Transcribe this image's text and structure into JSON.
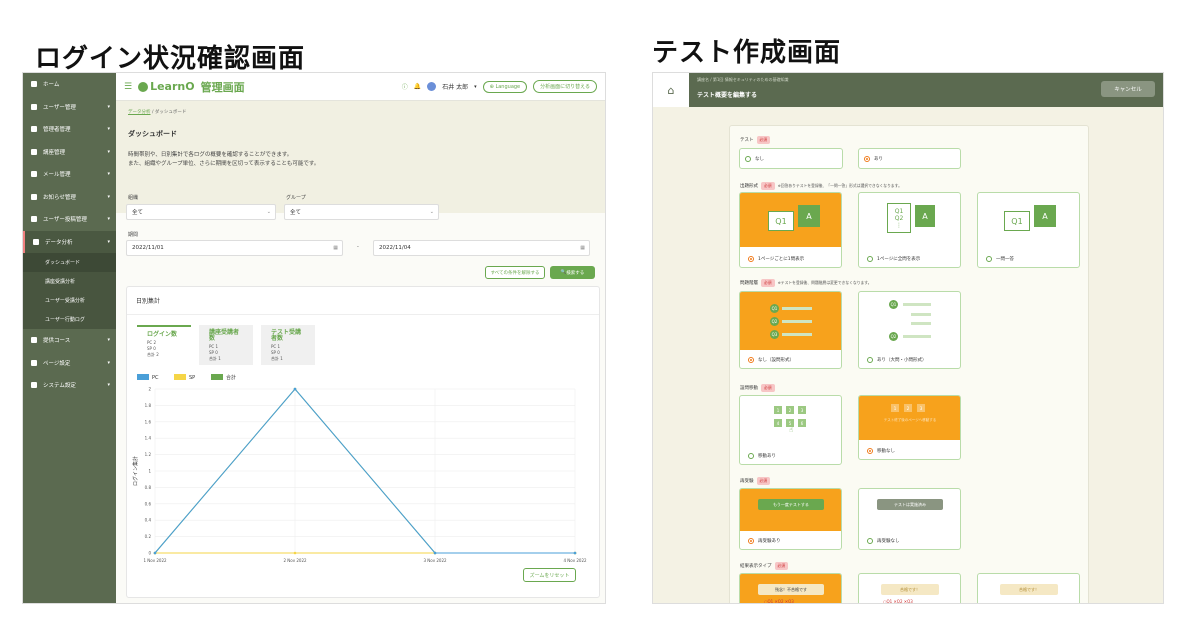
{
  "titles": {
    "left": "ログイン状況確認画面",
    "right": "テスト作成画面"
  },
  "left": {
    "sidebar": {
      "items": [
        {
          "label": "ホーム",
          "chevron": false
        },
        {
          "label": "ユーザー管理",
          "chevron": true
        },
        {
          "label": "管理者管理",
          "chevron": true
        },
        {
          "label": "講座管理",
          "chevron": true
        },
        {
          "label": "メール管理",
          "chevron": true
        },
        {
          "label": "お知らせ管理",
          "chevron": true
        },
        {
          "label": "ユーザー投稿管理",
          "chevron": true
        },
        {
          "label": "データ分析",
          "chevron": true,
          "active": true
        }
      ],
      "sub": [
        "ダッシュボード",
        "講座受講分析",
        "ユーザー受講分析",
        "ユーザー行動ログ"
      ],
      "items2": [
        {
          "label": "提供コース",
          "chevron": true
        },
        {
          "label": "ページ設定",
          "chevron": true
        },
        {
          "label": "システム設定",
          "chevron": true
        }
      ]
    },
    "topbar": {
      "logo": "LearnO",
      "admin": "管理画面",
      "user": "石井 太郎",
      "language": "Language",
      "switch": "分析画面に切り替える"
    },
    "breadcrumb": {
      "parent": "データ分析",
      "sep": "/",
      "current": "ダッシュボード"
    },
    "page_title": "ダッシュボード",
    "desc1": "時間帯別や、日別集計で各ログの概要を確認することができます。",
    "desc2": "また、組織やグループ単位、さらに期間を区切って表示することも可能です。",
    "filters": {
      "org_label": "組織",
      "org_value": "全て",
      "group_label": "グループ",
      "group_value": "全て",
      "period_label": "期間",
      "start": "2022/11/01",
      "sep": "-",
      "end": "2022/11/04",
      "reset": "すべての条件を解除する",
      "search": "検索する"
    },
    "card_title": "日別集計",
    "stats": [
      {
        "title": "ログイン数",
        "pc": "PC 2",
        "sp": "SP 0",
        "total": "合計 2"
      },
      {
        "title": "講座受講者数",
        "pc": "PC 1",
        "sp": "SP 0",
        "total": "合計 1"
      },
      {
        "title": "テスト受講者数",
        "pc": "PC 1",
        "sp": "SP 0",
        "total": "合計 1"
      }
    ],
    "zoom_reset": "ズームをリセット"
  },
  "chart_data": {
    "type": "line",
    "x": [
      "1 Nov 2022",
      "2 Nov 2022",
      "3 Nov 2022",
      "4 Nov 2022"
    ],
    "series": [
      {
        "name": "PC",
        "color": "#4a9fd8",
        "values": [
          0,
          2,
          0,
          0
        ]
      },
      {
        "name": "SP",
        "color": "#f5d547",
        "values": [
          0,
          0,
          0,
          0
        ]
      },
      {
        "name": "合計",
        "color": "#6aa84f",
        "values": [
          0,
          2,
          0,
          0
        ]
      }
    ],
    "ylabel": "ログイン集計",
    "ylim": [
      0,
      2
    ],
    "yticks": [
      "0",
      "0.2",
      "0.4",
      "0.6",
      "0.8",
      "1",
      "1.2",
      "1.4",
      "1.6",
      "1.8",
      "2"
    ],
    "grid": true,
    "legend": "top-left"
  },
  "right": {
    "topbar": {
      "subtitle": "講座名 / 第1回 情報セキュリティのための基礎知識",
      "title": "テスト概要を編集する",
      "cancel": "キャンセル"
    },
    "required": "必須",
    "test": {
      "label": "テスト",
      "opt1": "なし",
      "opt2": "あり"
    },
    "format": {
      "label": "出題形式",
      "note": "※回答ありテストを登録後、「一問一答」形式は選択できなくなります。",
      "opt1": "1ページごとに1問表示",
      "opt2": "1ページに全問を表示",
      "opt3": "一問一答"
    },
    "group": {
      "label": "問題階層",
      "note": "※テストを登録後、問題階層は変更できなくなります。",
      "opt1": "なし（設問形式）",
      "opt2": "あり（大問・小問形式）"
    },
    "move": {
      "label": "設問移動",
      "opt1": "移動あり",
      "opt2": "移動なし",
      "caption": "テスト終了後のページへ移動する"
    },
    "retake": {
      "label": "再受験",
      "opt1": "再受験あり",
      "opt2": "再受験なし",
      "btn1": "もう一度テストする",
      "btn2": "テストは実施済み"
    },
    "result": {
      "label": "結果表示タイプ",
      "r1": "残念！不合格です",
      "r2": "合格です！",
      "r3": "合格です！"
    }
  },
  "colors": {
    "green": "#6aa84f",
    "sidebar": "#5b6a50",
    "orange": "#f7a21c"
  }
}
